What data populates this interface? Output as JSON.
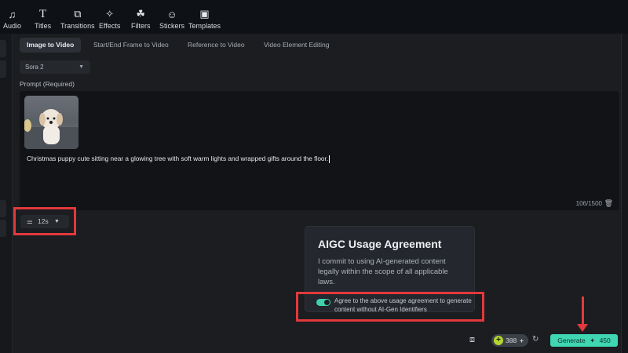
{
  "toolbar": {
    "items": [
      {
        "label": "Audio",
        "icon": "music-icon"
      },
      {
        "label": "Titles",
        "icon": "text-icon"
      },
      {
        "label": "Transitions",
        "icon": "transitions-icon"
      },
      {
        "label": "Effects",
        "icon": "effects-icon"
      },
      {
        "label": "Filters",
        "icon": "filters-icon"
      },
      {
        "label": "Stickers",
        "icon": "stickers-icon"
      },
      {
        "label": "Templates",
        "icon": "templates-icon"
      }
    ]
  },
  "tabs": [
    {
      "label": "Image to Video",
      "active": true
    },
    {
      "label": "Start/End Frame to Video"
    },
    {
      "label": "Reference to Video"
    },
    {
      "label": "Video Element Editing"
    }
  ],
  "model_select": {
    "value": "Sora 2"
  },
  "prompt": {
    "label": "Prompt (Required)",
    "text": "Christmas puppy cute sitting near a glowing tree with soft warm lights and wrapped gifts around the floor.",
    "count": "106/1500"
  },
  "duration": {
    "value": "12s"
  },
  "agreement": {
    "title": "AIGC Usage Agreement",
    "body": "I commit to using AI-generated content legally within the scope of all applicable laws.",
    "toggle_label": "Agree to the above usage agreement to generate content without AI-Gen Identifiers",
    "toggle_on": true
  },
  "footer": {
    "credits": "388",
    "generate_label": "Generate",
    "generate_cost": "450"
  },
  "colors": {
    "accent": "#3fd6b2",
    "highlight": "#e2393c"
  }
}
